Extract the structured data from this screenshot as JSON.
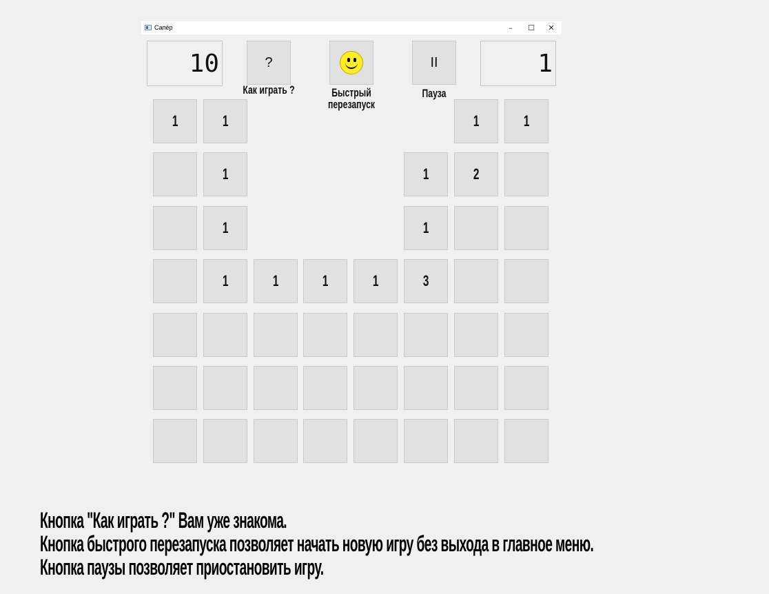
{
  "window": {
    "title": "Сапёр",
    "minimize": "–",
    "maximize": "☐",
    "close": "✕"
  },
  "counters": {
    "mines_left": "10",
    "timer": "1"
  },
  "toolbar": {
    "help_button": "?",
    "help_label": "Как играть ?",
    "restart_label": "Быстрый\nперезапуск",
    "pause_button": "II",
    "pause_label": "Пауза"
  },
  "board": {
    "columns": 8,
    "rows": [
      [
        {
          "state": "closed",
          "value": "1"
        },
        {
          "state": "closed",
          "value": "1"
        },
        {
          "state": "open",
          "value": ""
        },
        {
          "state": "open",
          "value": ""
        },
        {
          "state": "open",
          "value": ""
        },
        {
          "state": "open",
          "value": ""
        },
        {
          "state": "closed",
          "value": "1"
        },
        {
          "state": "closed",
          "value": "1"
        }
      ],
      [
        {
          "state": "closed",
          "value": ""
        },
        {
          "state": "closed",
          "value": "1"
        },
        {
          "state": "open",
          "value": ""
        },
        {
          "state": "open",
          "value": ""
        },
        {
          "state": "open",
          "value": ""
        },
        {
          "state": "closed",
          "value": "1"
        },
        {
          "state": "closed",
          "value": "2"
        },
        {
          "state": "closed",
          "value": ""
        }
      ],
      [
        {
          "state": "closed",
          "value": ""
        },
        {
          "state": "closed",
          "value": "1"
        },
        {
          "state": "open",
          "value": ""
        },
        {
          "state": "open",
          "value": ""
        },
        {
          "state": "open",
          "value": ""
        },
        {
          "state": "closed",
          "value": "1"
        },
        {
          "state": "closed",
          "value": ""
        },
        {
          "state": "closed",
          "value": ""
        }
      ],
      [
        {
          "state": "closed",
          "value": ""
        },
        {
          "state": "closed",
          "value": "1"
        },
        {
          "state": "closed",
          "value": "1"
        },
        {
          "state": "closed",
          "value": "1"
        },
        {
          "state": "closed",
          "value": "1"
        },
        {
          "state": "closed",
          "value": "3"
        },
        {
          "state": "closed",
          "value": ""
        },
        {
          "state": "closed",
          "value": ""
        }
      ],
      [
        {
          "state": "closed",
          "value": ""
        },
        {
          "state": "closed",
          "value": ""
        },
        {
          "state": "closed",
          "value": ""
        },
        {
          "state": "closed",
          "value": ""
        },
        {
          "state": "closed",
          "value": ""
        },
        {
          "state": "closed",
          "value": ""
        },
        {
          "state": "closed",
          "value": ""
        },
        {
          "state": "closed",
          "value": ""
        }
      ],
      [
        {
          "state": "closed",
          "value": ""
        },
        {
          "state": "closed",
          "value": ""
        },
        {
          "state": "closed",
          "value": ""
        },
        {
          "state": "closed",
          "value": ""
        },
        {
          "state": "closed",
          "value": ""
        },
        {
          "state": "closed",
          "value": ""
        },
        {
          "state": "closed",
          "value": ""
        },
        {
          "state": "closed",
          "value": ""
        }
      ],
      [
        {
          "state": "closed",
          "value": ""
        },
        {
          "state": "closed",
          "value": ""
        },
        {
          "state": "closed",
          "value": ""
        },
        {
          "state": "closed",
          "value": ""
        },
        {
          "state": "closed",
          "value": ""
        },
        {
          "state": "closed",
          "value": ""
        },
        {
          "state": "closed",
          "value": ""
        },
        {
          "state": "closed",
          "value": ""
        }
      ]
    ]
  },
  "instructions": {
    "line1": "Кнопка \"Как играть ?\" Вам уже знакома.",
    "line2": "Кнопка быстрого перезапуска позволяет начать новую игру без выхода в главное меню.",
    "line3": "Кнопка паузы позволяет приостановить игру."
  },
  "icons": {
    "app": "minesweeper-app-icon",
    "restart": "smiley-face-icon"
  },
  "colors": {
    "background": "#f0f0f0",
    "cell": "#e1e1e1",
    "smiley": "#ffee22"
  }
}
